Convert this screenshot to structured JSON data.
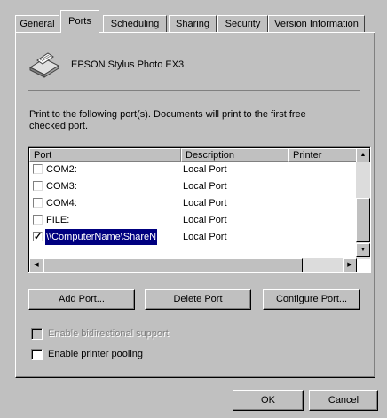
{
  "tabs": [
    "General",
    "Ports",
    "Scheduling",
    "Sharing",
    "Security",
    "Version Information"
  ],
  "printer_name": "EPSON Stylus Photo EX3",
  "instruction": "Print to the following port(s).  Documents will print to the first free checked port.",
  "columns": [
    "Port",
    "Description",
    "Printer"
  ],
  "ports": [
    {
      "name": "COM2:",
      "description": "Local Port",
      "checked": false
    },
    {
      "name": "COM3:",
      "description": "Local Port",
      "checked": false
    },
    {
      "name": "COM4:",
      "description": "Local Port",
      "checked": false
    },
    {
      "name": "FILE:",
      "description": "Local Port",
      "checked": false
    },
    {
      "name": "\\\\ComputerName\\ShareN",
      "description": "Local Port",
      "checked": true
    }
  ],
  "buttons": {
    "add_port": "Add Port...",
    "delete_port": "Delete Port",
    "configure_port": "Configure Port...",
    "ok": "OK",
    "cancel": "Cancel"
  },
  "options": {
    "bidirectional": "Enable bidirectional support",
    "pooling": "Enable printer pooling"
  },
  "icons": {
    "printer": "printer-icon"
  }
}
